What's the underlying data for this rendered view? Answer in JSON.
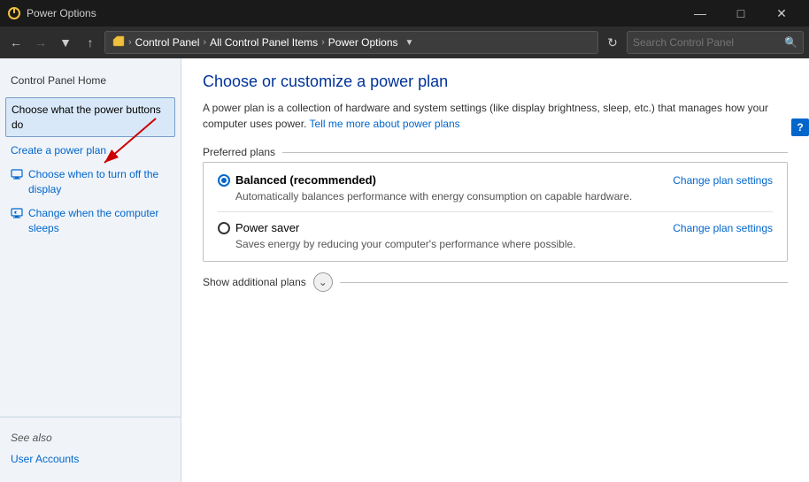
{
  "window": {
    "title": "Power Options",
    "icon": "power-icon"
  },
  "titlebar": {
    "minimize_label": "—",
    "maximize_label": "□",
    "close_label": "✕"
  },
  "addressbar": {
    "back_title": "Back",
    "forward_title": "Forward",
    "up_title": "Up",
    "path": {
      "root_icon": "folder-icon",
      "items": [
        "Control Panel",
        "All Control Panel Items",
        "Power Options"
      ]
    },
    "refresh_title": "Refresh",
    "search_placeholder": "Search Control Panel"
  },
  "sidebar": {
    "home_label": "Control Panel Home",
    "items": [
      {
        "id": "power-buttons",
        "label": "Choose what the power buttons do",
        "selected": true,
        "has_icon": false
      },
      {
        "id": "create-plan",
        "label": "Create a power plan",
        "selected": false,
        "has_icon": false
      },
      {
        "id": "display-off",
        "label": "Choose when to turn off the display",
        "selected": false,
        "has_icon": true
      },
      {
        "id": "sleep",
        "label": "Change when the computer sleeps",
        "selected": false,
        "has_icon": true
      }
    ],
    "see_also_label": "See also",
    "footer_links": [
      {
        "id": "user-accounts",
        "label": "User Accounts"
      }
    ]
  },
  "content": {
    "title": "Choose or customize a power plan",
    "description": "A power plan is a collection of hardware and system settings (like display brightness, sleep, etc.) that manages how your computer uses power.",
    "learn_more_link": "Tell me more about power plans",
    "preferred_plans_label": "Preferred plans",
    "plans": [
      {
        "id": "balanced",
        "name": "Balanced (recommended)",
        "selected": true,
        "description": "Automatically balances performance with energy consumption on capable hardware.",
        "change_settings_label": "Change plan settings"
      },
      {
        "id": "power-saver",
        "name": "Power saver",
        "selected": false,
        "description": "Saves energy by reducing your computer's performance where possible.",
        "change_settings_label": "Change plan settings"
      }
    ],
    "show_additional_label": "Show additional plans"
  }
}
